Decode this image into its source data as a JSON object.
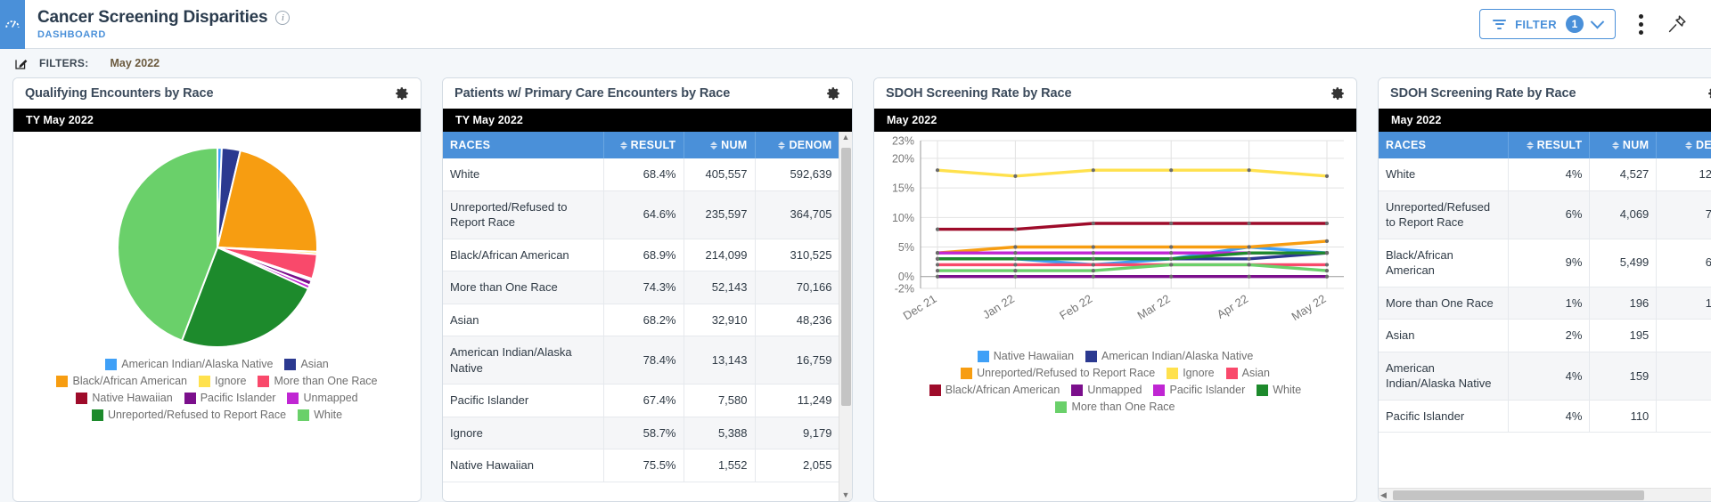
{
  "header": {
    "title": "Cancer Screening Disparities",
    "subtitle": "DASHBOARD",
    "info_icon": "info-icon",
    "app_icon": "dashboard-gauge-icon",
    "filter_button": {
      "label": "FILTER",
      "count": "1",
      "icon": "filter-funnel-icon",
      "chevron": "chevron-down-icon"
    },
    "kebab_icon": "more-options-icon",
    "pin_icon": "pin-icon"
  },
  "filterbar": {
    "edit_icon": "edit-pencil-icon",
    "label": "FILTERS:",
    "value": "May 2022"
  },
  "colors": {
    "accent": "#4a90d9",
    "american_indian": "#3fa0f7",
    "asian_navy": "#2b3990",
    "black_orange": "#f79d11",
    "ignore_yellow": "#ffe14d",
    "more_than_one_pink": "#f9496b",
    "native_hawaiian_darkred": "#9e0b2a",
    "pacific_islander_purple": "#7b0f8c",
    "unmapped_magenta": "#c026d3",
    "unreported_darkgreen": "#1d8a2c",
    "white_lightgreen": "#6ad06a"
  },
  "panels": [
    {
      "title": "Qualifying Encounters by Race",
      "gear_icon": "gear-icon",
      "period": "TY May 2022",
      "type": "pie"
    },
    {
      "title": "Patients w/ Primary Care Encounters by Race",
      "gear_icon": "gear-icon",
      "period": "TY May 2022",
      "type": "table",
      "columns": [
        "RACES",
        "RESULT",
        "NUM",
        "DENOM"
      ],
      "rows": [
        [
          "White",
          "68.4%",
          "405,557",
          "592,639"
        ],
        [
          "Unreported/Refused to Report Race",
          "64.6%",
          "235,597",
          "364,705"
        ],
        [
          "Black/African American",
          "68.9%",
          "214,099",
          "310,525"
        ],
        [
          "More than One Race",
          "74.3%",
          "52,143",
          "70,166"
        ],
        [
          "Asian",
          "68.2%",
          "32,910",
          "48,236"
        ],
        [
          "American Indian/Alaska Native",
          "78.4%",
          "13,143",
          "16,759"
        ],
        [
          "Pacific Islander",
          "67.4%",
          "7,580",
          "11,249"
        ],
        [
          "Ignore",
          "58.7%",
          "5,388",
          "9,179"
        ],
        [
          "Native Hawaiian",
          "75.5%",
          "1,552",
          "2,055"
        ]
      ]
    },
    {
      "title": "SDOH Screening Rate by Race",
      "gear_icon": "gear-icon",
      "period": "May 2022",
      "type": "line"
    },
    {
      "title": "SDOH Screening Rate by Race",
      "gear_icon": "gear-icon",
      "period": "May 2022",
      "type": "table",
      "columns": [
        "RACES",
        "RESULT",
        "NUM",
        "DE"
      ],
      "rows": [
        [
          "White",
          "4%",
          "4,527",
          "12"
        ],
        [
          "Unreported/Refused to Report Race",
          "6%",
          "4,069",
          "7"
        ],
        [
          "Black/African American",
          "9%",
          "5,499",
          "6"
        ],
        [
          "More than One Race",
          "1%",
          "196",
          "1"
        ],
        [
          "Asian",
          "2%",
          "195",
          ""
        ],
        [
          "American Indian/Alaska Native",
          "4%",
          "159",
          ""
        ],
        [
          "Pacific Islander",
          "4%",
          "110",
          ""
        ]
      ]
    }
  ],
  "chart_data": [
    {
      "type": "pie",
      "title": "Qualifying Encounters by Race",
      "legend_position": "bottom",
      "categories": [
        "American Indian/Alaska Native",
        "Asian",
        "Black/African American",
        "Ignore",
        "More than One Race",
        "Native Hawaiian",
        "Pacific Islander",
        "Unmapped",
        "Unreported/Refused to Report Race",
        "White"
      ],
      "colors": [
        "#3fa0f7",
        "#2b3990",
        "#f79d11",
        "#ffe14d",
        "#f9496b",
        "#9e0b2a",
        "#7b0f8c",
        "#c026d3",
        "#1d8a2c",
        "#6ad06a"
      ],
      "values": [
        0.7,
        3.0,
        22.0,
        0.4,
        4.0,
        0.3,
        0.8,
        0.6,
        24.0,
        44.2
      ],
      "unit": "percent"
    },
    {
      "type": "line",
      "title": "SDOH Screening Rate by Race",
      "xlabel": "",
      "ylabel": "",
      "ylim": [
        -2,
        23
      ],
      "yticks": [
        "-2%",
        "0%",
        "5%",
        "10%",
        "15%",
        "20%",
        "23%"
      ],
      "grid": true,
      "legend_position": "bottom",
      "x": [
        "Dec 21",
        "Jan 22",
        "Feb 22",
        "Mar 22",
        "Apr 22",
        "May 22"
      ],
      "series": [
        {
          "name": "Native Hawaiian",
          "color": "#3fa0f7",
          "values": [
            3,
            3,
            2,
            3,
            5,
            4
          ]
        },
        {
          "name": "American Indian/Alaska Native",
          "color": "#2b3990",
          "values": [
            3,
            3,
            3,
            3,
            3,
            4
          ]
        },
        {
          "name": "Unreported/Refused to Report Race",
          "color": "#f79d11",
          "values": [
            4,
            5,
            5,
            5,
            5,
            6
          ]
        },
        {
          "name": "Ignore",
          "color": "#ffe14d",
          "values": [
            18,
            17,
            18,
            18,
            18,
            17
          ]
        },
        {
          "name": "Asian",
          "color": "#f9496b",
          "values": [
            2,
            2,
            2,
            2,
            2,
            2
          ]
        },
        {
          "name": "Black/African American",
          "color": "#9e0b2a",
          "values": [
            8,
            8,
            9,
            9,
            9,
            9
          ]
        },
        {
          "name": "Unmapped",
          "color": "#7b0f8c",
          "values": [
            0,
            0,
            0,
            0,
            0,
            0
          ]
        },
        {
          "name": "Pacific Islander",
          "color": "#c026d3",
          "values": [
            4,
            4,
            4,
            4,
            4,
            4
          ]
        },
        {
          "name": "White",
          "color": "#1d8a2c",
          "values": [
            3,
            3,
            3,
            3,
            4,
            4
          ]
        },
        {
          "name": "More than One Race",
          "color": "#6ad06a",
          "values": [
            1,
            1,
            1,
            2,
            2,
            1
          ]
        }
      ]
    }
  ],
  "pie_legend_rows": [
    [
      {
        "label": "American Indian/Alaska Native",
        "color": "#3fa0f7"
      },
      {
        "label": "Asian",
        "color": "#2b3990"
      }
    ],
    [
      {
        "label": "Black/African American",
        "color": "#f79d11"
      },
      {
        "label": "Ignore",
        "color": "#ffe14d"
      },
      {
        "label": "More than One Race",
        "color": "#f9496b"
      }
    ],
    [
      {
        "label": "Native Hawaiian",
        "color": "#9e0b2a"
      },
      {
        "label": "Pacific Islander",
        "color": "#7b0f8c"
      },
      {
        "label": "Unmapped",
        "color": "#c026d3"
      }
    ],
    [
      {
        "label": "Unreported/Refused to Report Race",
        "color": "#1d8a2c"
      },
      {
        "label": "White",
        "color": "#6ad06a"
      }
    ]
  ],
  "line_legend_rows": [
    [
      {
        "label": "Native Hawaiian",
        "color": "#3fa0f7"
      },
      {
        "label": "American Indian/Alaska Native",
        "color": "#2b3990"
      }
    ],
    [
      {
        "label": "Unreported/Refused to Report Race",
        "color": "#f79d11"
      },
      {
        "label": "Ignore",
        "color": "#ffe14d"
      },
      {
        "label": "Asian",
        "color": "#f9496b"
      }
    ],
    [
      {
        "label": "Black/African American",
        "color": "#9e0b2a"
      },
      {
        "label": "Unmapped",
        "color": "#7b0f8c"
      },
      {
        "label": "Pacific Islander",
        "color": "#c026d3"
      },
      {
        "label": "White",
        "color": "#1d8a2c"
      }
    ],
    [
      {
        "label": "More than One Race",
        "color": "#6ad06a"
      }
    ]
  ]
}
